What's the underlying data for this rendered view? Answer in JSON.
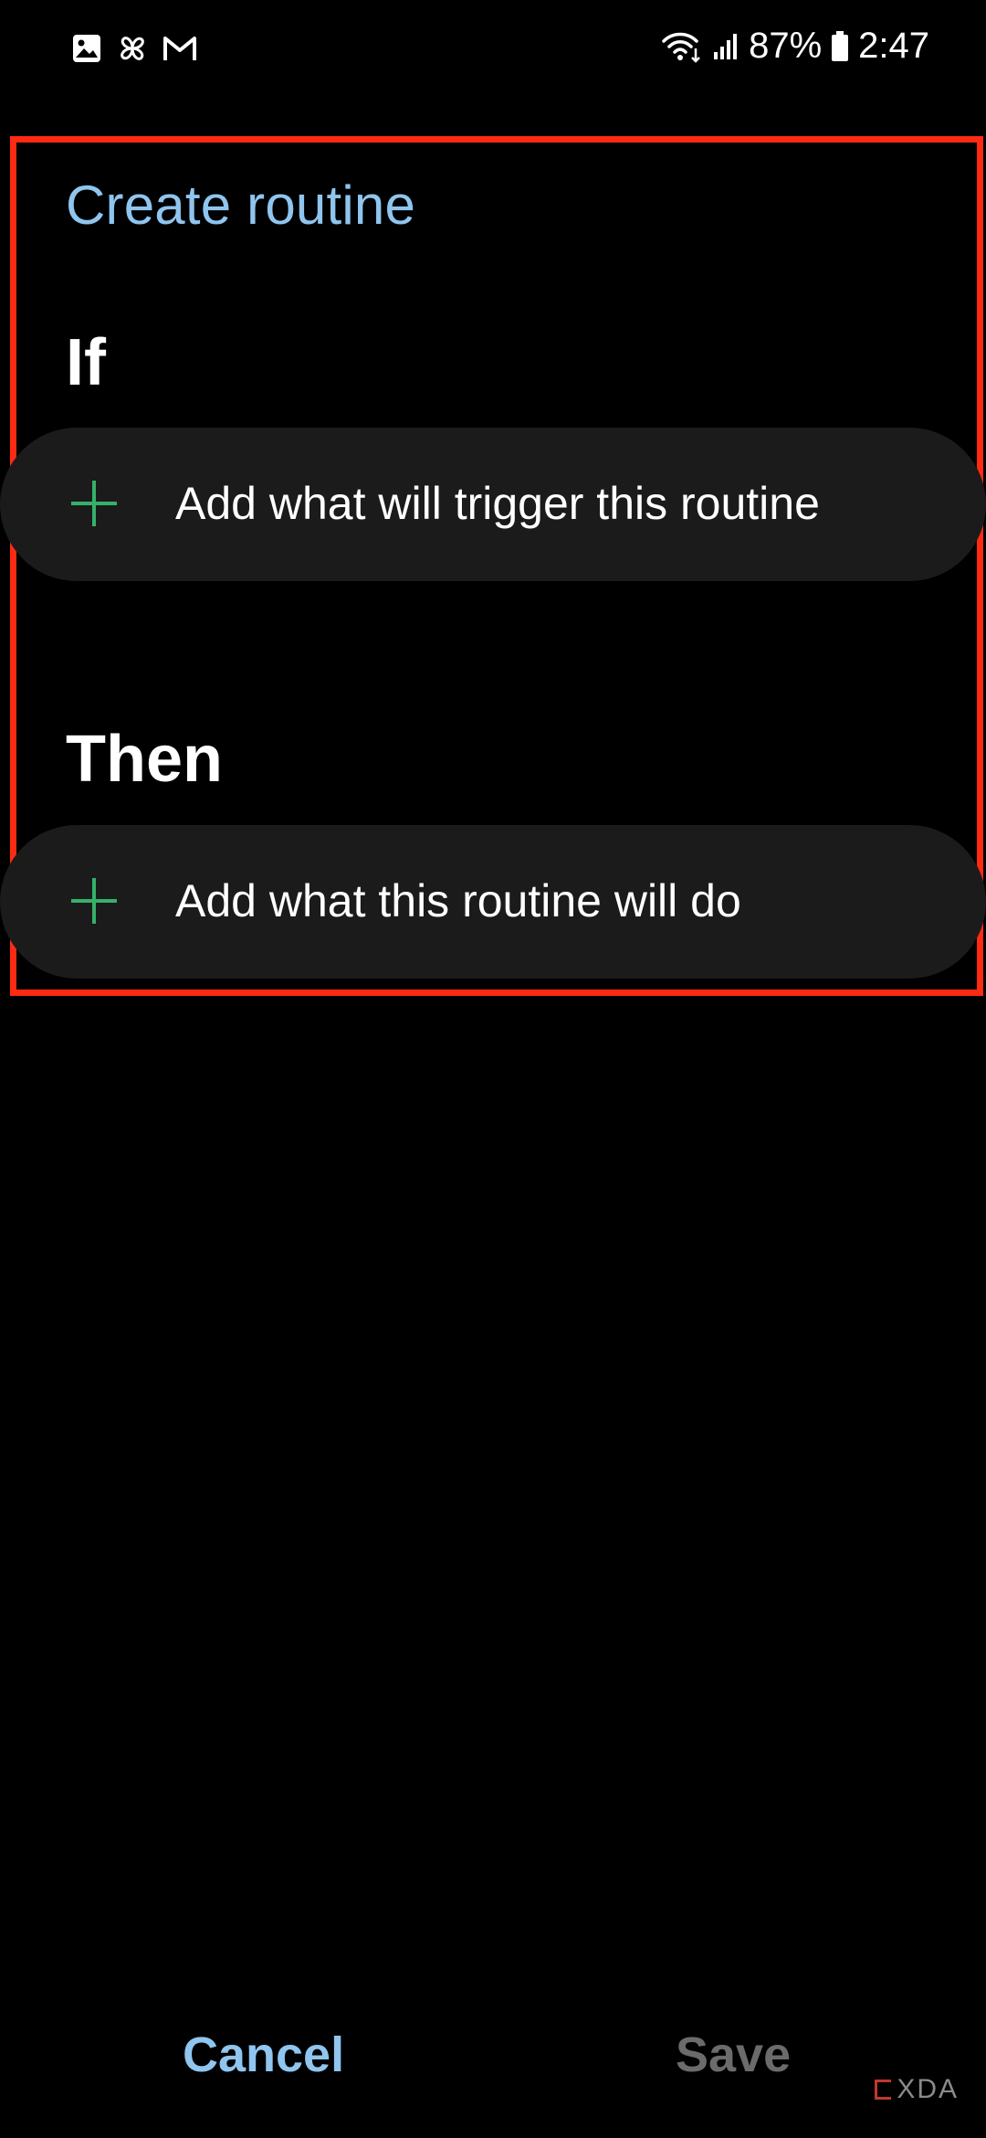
{
  "status_bar": {
    "battery": "87%",
    "time": "2:47",
    "left_icons": [
      "gallery-icon",
      "pinwheel-icon",
      "gmail-icon"
    ],
    "right_icons": [
      "wifi-icon",
      "signal-icon",
      "battery-icon"
    ]
  },
  "page": {
    "title": "Create routine"
  },
  "if_section": {
    "heading": "If",
    "add_label": "Add what will trigger this routine",
    "icon": "plus-icon"
  },
  "then_section": {
    "heading": "Then",
    "add_label": "Add what this routine will do",
    "icon": "plus-icon"
  },
  "bottom_bar": {
    "cancel_label": "Cancel",
    "save_label": "Save"
  },
  "watermark": {
    "text": "XDA"
  },
  "colors": {
    "background": "#000000",
    "accent": "#8fc5ee",
    "plus": "#35b06a",
    "card": "#1b1b1b",
    "highlight": "#ff2a12",
    "disabled": "#6b6b6b"
  }
}
